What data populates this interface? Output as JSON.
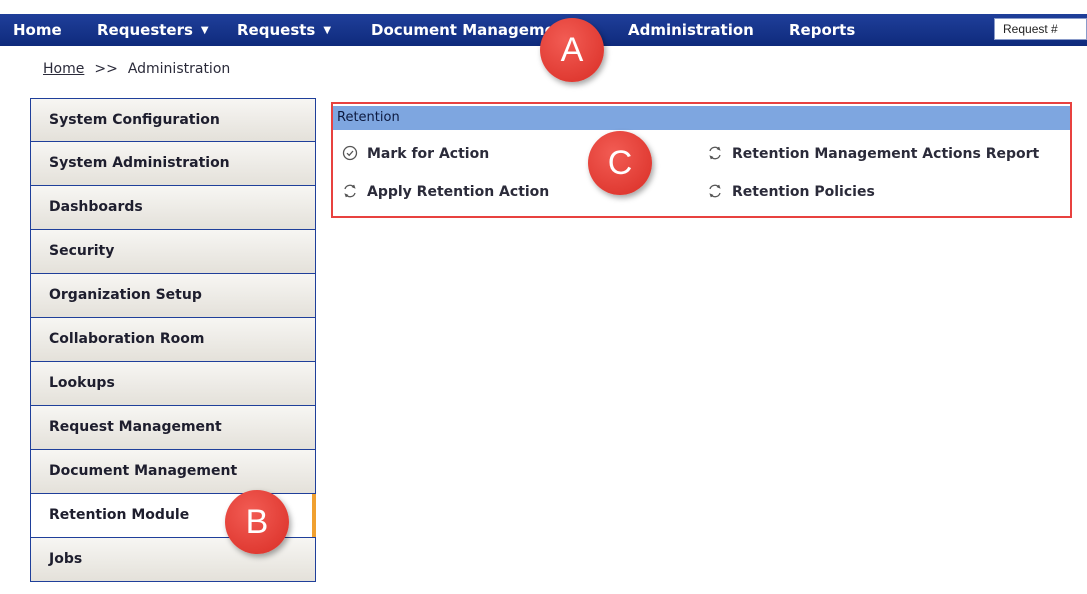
{
  "nav": {
    "items": [
      {
        "label": "Home",
        "dropdown": false
      },
      {
        "label": "Requesters",
        "dropdown": true
      },
      {
        "label": "Requests",
        "dropdown": true
      },
      {
        "label": "Document Management",
        "dropdown": false
      },
      {
        "label": "Administration",
        "dropdown": false
      },
      {
        "label": "Reports",
        "dropdown": false
      }
    ],
    "request_placeholder": "Request #"
  },
  "breadcrumb": {
    "home": "Home",
    "separator": ">>",
    "current": "Administration"
  },
  "sidebar": {
    "items": [
      {
        "label": "System Configuration"
      },
      {
        "label": "System Administration"
      },
      {
        "label": "Dashboards"
      },
      {
        "label": "Security"
      },
      {
        "label": "Organization Setup"
      },
      {
        "label": "Collaboration Room"
      },
      {
        "label": "Lookups"
      },
      {
        "label": "Request Management"
      },
      {
        "label": "Document Management"
      },
      {
        "label": "Retention Module",
        "active": true
      },
      {
        "label": "Jobs"
      }
    ]
  },
  "panel": {
    "title": "Retention",
    "links": [
      {
        "label": "Mark for Action",
        "icon": "check-circle-icon"
      },
      {
        "label": "Apply Retention Action",
        "icon": "refresh-icon"
      },
      {
        "label": "Retention Management Actions Report",
        "icon": "refresh-icon"
      },
      {
        "label": "Retention Policies",
        "icon": "refresh-icon"
      }
    ]
  },
  "markers": {
    "a": "A",
    "b": "B",
    "c": "C"
  },
  "colors": {
    "nav": "#1f3f9a",
    "panel_header": "#7ea6e0",
    "highlight": "#e8413f",
    "marker": "#e0362f",
    "active_tab": "#f0a030"
  }
}
